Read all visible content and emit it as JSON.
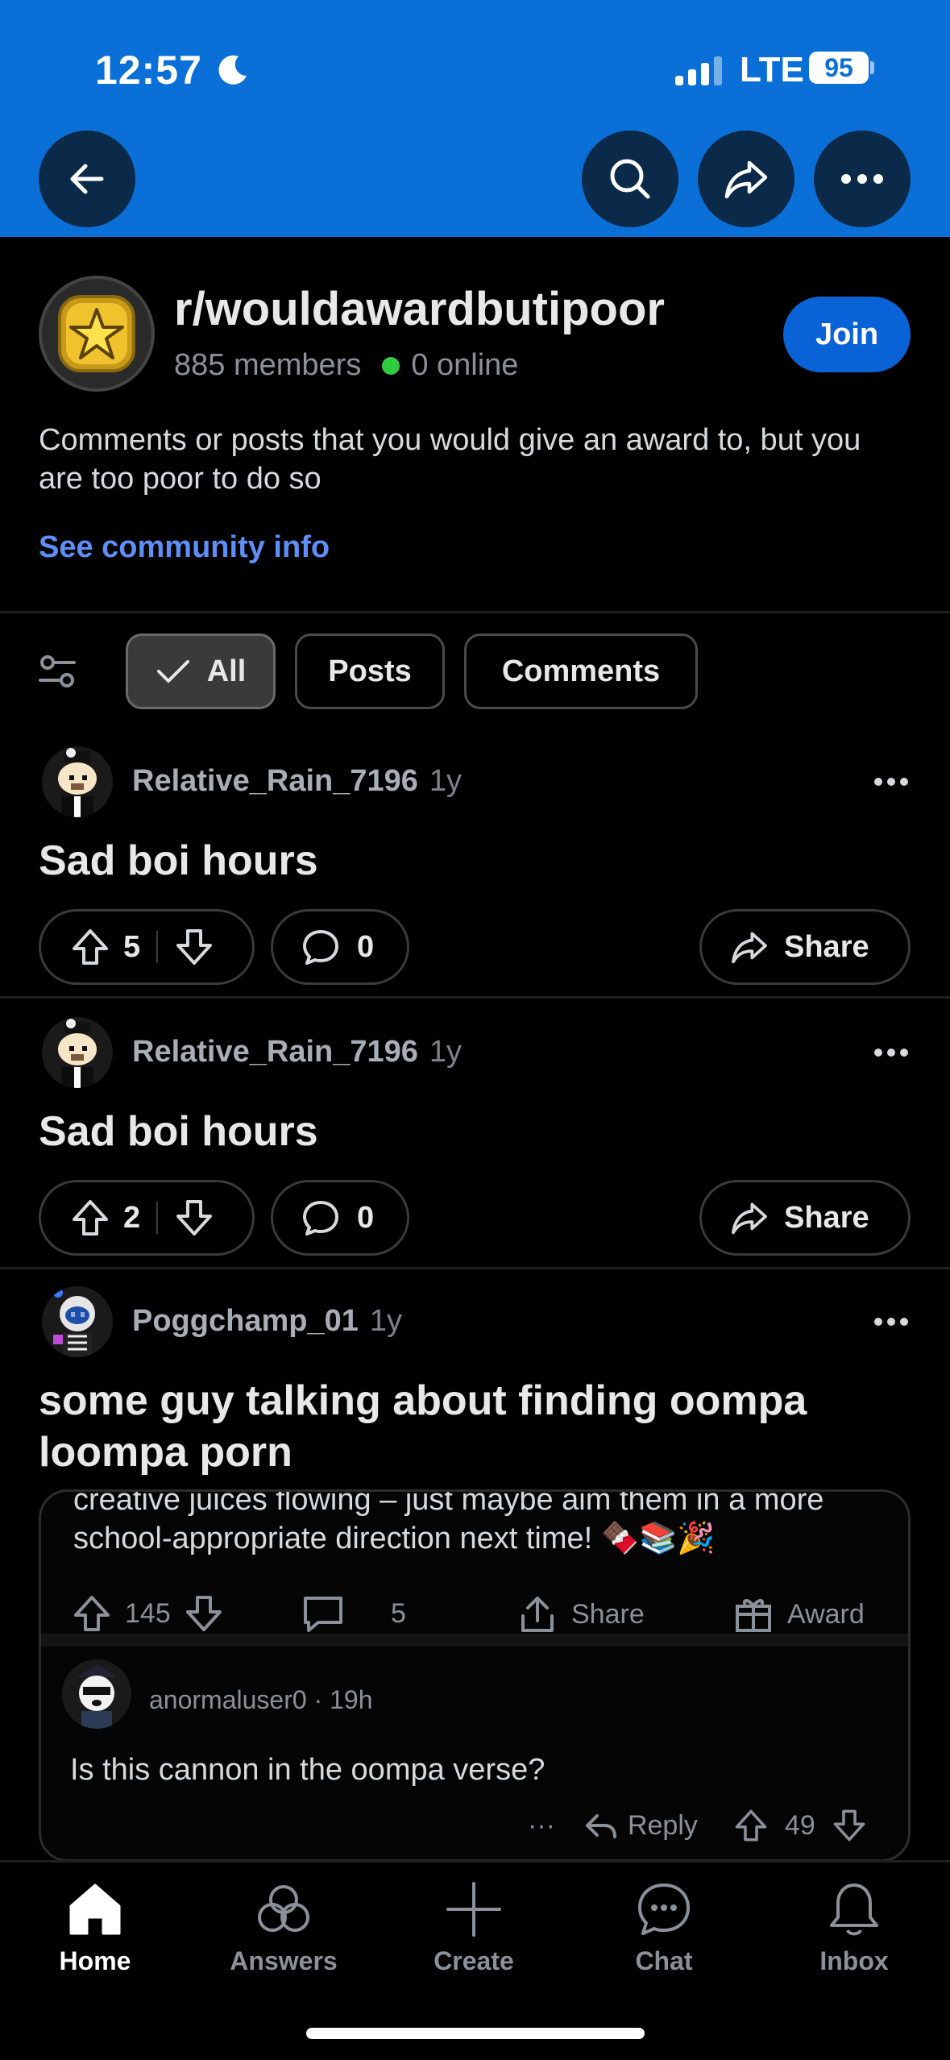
{
  "status_bar": {
    "time": "12:57",
    "network": "LTE",
    "battery": "95"
  },
  "top_bar": {
    "back": "back",
    "search": "search",
    "share": "share",
    "more": "more"
  },
  "community": {
    "name": "r/wouldawardbutipoor",
    "members": "885 members",
    "online": "0 online",
    "join_label": "Join",
    "description": "Comments or posts that you would give an award to, but you are too poor to do so",
    "info_link": "See community info"
  },
  "filters": {
    "items": [
      {
        "label": "All",
        "active": true
      },
      {
        "label": "Posts",
        "active": false
      },
      {
        "label": "Comments",
        "active": false
      }
    ]
  },
  "posts": [
    {
      "author": "Relative_Rain_7196",
      "age": "1y",
      "title": "Sad boi hours",
      "votes": "5",
      "comments": "0",
      "share_label": "Share"
    },
    {
      "author": "Relative_Rain_7196",
      "age": "1y",
      "title": "Sad boi hours",
      "votes": "2",
      "comments": "0",
      "share_label": "Share"
    },
    {
      "author": "Poggchamp_01",
      "age": "1y",
      "title": "some guy talking about finding oompa loompa porn"
    }
  ],
  "embed": {
    "text": "creative juices flowing – just maybe aim them in a more school-appropriate direction next time! 🍫📚🎉",
    "votes": "145",
    "comments": "5",
    "share_label": "Share",
    "award_label": "Award",
    "comment": {
      "author": "anormaluser0",
      "age": "19h",
      "text": "Is this cannon in the oompa verse?",
      "reply_label": "Reply",
      "more": "···",
      "votes": "49"
    }
  },
  "bottom_nav": {
    "items": [
      {
        "label": "Home",
        "icon": "home-icon",
        "active": true
      },
      {
        "label": "Answers",
        "icon": "answers-icon",
        "active": false
      },
      {
        "label": "Create",
        "icon": "plus-icon",
        "active": false
      },
      {
        "label": "Chat",
        "icon": "chat-icon",
        "active": false
      },
      {
        "label": "Inbox",
        "icon": "bell-icon",
        "active": false
      }
    ]
  },
  "colors": {
    "brand_blue": "#0a6fd6",
    "join_blue": "#0a63d6",
    "link_blue": "#5d8ff7",
    "online_green": "#2ecc40"
  }
}
